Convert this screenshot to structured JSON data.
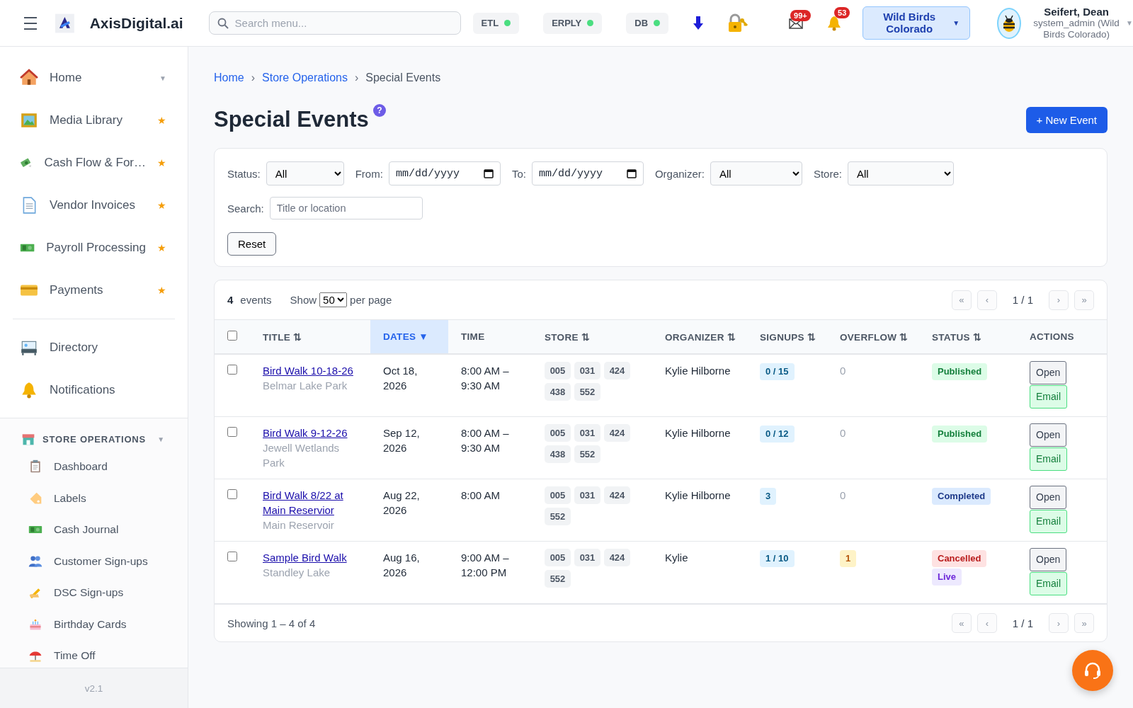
{
  "header": {
    "brand": "AxisDigital.ai",
    "search": {
      "placeholder": "Search menu..."
    },
    "status_chips": [
      {
        "label": "ETL",
        "color": "#4ade80"
      },
      {
        "label": "ERPLY",
        "color": "#4ade80"
      },
      {
        "label": "DB",
        "color": "#4ade80"
      }
    ],
    "mail_badge": "99+",
    "bell_badge": "53",
    "store_button": "Wild Birds Colorado",
    "store_caret": "▼",
    "user": {
      "name": "Seifert, Dean",
      "role": "system_admin (Wild Birds Colorado)",
      "caret": "▼"
    }
  },
  "sidebar": {
    "items": [
      {
        "label": "Home",
        "kind": "caret",
        "trailing_text": "▼"
      },
      {
        "label": "Media Library",
        "kind": "star",
        "trailing_text": "★"
      },
      {
        "label": "Cash Flow & For…",
        "kind": "star",
        "trailing_text": "★"
      },
      {
        "label": "Vendor Invoices",
        "kind": "star",
        "trailing_text": "★"
      },
      {
        "label": "Payroll Processing",
        "kind": "star",
        "trailing_text": "★"
      },
      {
        "label": "Payments",
        "kind": "star",
        "trailing_text": "★"
      }
    ],
    "items_2": [
      {
        "label": "Directory"
      },
      {
        "label": "Notifications"
      }
    ],
    "section": {
      "title": "STORE OPERATIONS",
      "caret": "▼",
      "expanded": true,
      "children": [
        {
          "label": "Dashboard"
        },
        {
          "label": "Labels"
        },
        {
          "label": "Cash Journal"
        },
        {
          "label": "Customer Sign-ups"
        },
        {
          "label": "DSC Sign-ups"
        },
        {
          "label": "Birthday Cards"
        },
        {
          "label": "Time Off"
        }
      ]
    },
    "version": "v2.1"
  },
  "breadcrumb": [
    {
      "label": "Home",
      "link": true
    },
    {
      "label": "Store Operations",
      "link": true
    },
    {
      "label": "Special Events",
      "link": false
    }
  ],
  "breadcrumb_separators": [
    "›",
    "›"
  ],
  "page_title": "Special Events",
  "help": "?",
  "new_button": "+ New Event",
  "filters": [
    {
      "label": "Status:",
      "kind": "select",
      "value": "All"
    },
    {
      "label": "From:",
      "kind": "date",
      "placeholder": "mm/dd/yyyy"
    },
    {
      "label": "To:",
      "kind": "date",
      "placeholder": "mm/dd/yyyy"
    },
    {
      "label": "Organizer:",
      "kind": "select",
      "value": "All"
    },
    {
      "label": "Store:",
      "kind": "select",
      "value": "All"
    },
    {
      "label": "Search:",
      "kind": "text",
      "placeholder": "Title or location"
    }
  ],
  "reset_button": "Reset",
  "summary": {
    "count": "4",
    "count_label": "events",
    "show": "Show",
    "per_page": "50",
    "per_page_label": "per page"
  },
  "pager_top": {
    "buttons": [
      {
        "label": "«",
        "disabled": true
      },
      {
        "label": "‹",
        "disabled": true
      },
      {
        "label": "›",
        "disabled": true
      },
      {
        "label": "»",
        "disabled": true
      }
    ],
    "page": "1 / 1"
  },
  "table": {
    "select_all": {
      "checked": false
    },
    "columns": [
      {
        "label": "TITLE",
        "sort_icon": "⇅",
        "selected": false
      },
      {
        "label": "DATES",
        "sort_icon": "▼",
        "selected": true
      },
      {
        "label": "TIME",
        "selected": false
      },
      {
        "label": "STORE",
        "sort_icon": "⇅",
        "selected": false
      },
      {
        "label": "ORGANIZER",
        "sort_icon": "⇅",
        "selected": false
      },
      {
        "label": "SIGNUPS",
        "sort_icon": "⇅",
        "selected": false
      },
      {
        "label": "OVERFLOW",
        "sort_icon": "⇅",
        "selected": false
      },
      {
        "label": "STATUS",
        "sort_icon": "⇅",
        "selected": false
      },
      {
        "label": "ACTIONS",
        "selected": false
      }
    ],
    "rows": [
      {
        "checked": false,
        "title": "Bird Walk 10-18-26",
        "location": "Belmar Lake Park",
        "date": "Oct 18, 2026",
        "time": "8:00 AM – 9:30 AM",
        "stores": [
          "005",
          "031",
          "424",
          "438",
          "552"
        ],
        "organizer": "Kylie Hilborne",
        "signups": "0 / 15",
        "overflow": "0",
        "overflow_flag": false,
        "statuses": [
          {
            "label": "Published",
            "kind": "published"
          }
        ],
        "actions": [
          "Open",
          "Email"
        ]
      },
      {
        "checked": false,
        "title": "Bird Walk 9-12-26",
        "location": "Jewell Wetlands Park",
        "date": "Sep 12, 2026",
        "time": "8:00 AM – 9:30 AM",
        "stores": [
          "005",
          "031",
          "424",
          "438",
          "552"
        ],
        "organizer": "Kylie Hilborne",
        "signups": "0 / 12",
        "overflow": "0",
        "overflow_flag": false,
        "statuses": [
          {
            "label": "Published",
            "kind": "published"
          }
        ],
        "actions": [
          "Open",
          "Email"
        ]
      },
      {
        "checked": false,
        "title": "Bird Walk 8/22 at Main Reservior",
        "location": "Main Reservoir",
        "date": "Aug 22, 2026",
        "time": "8:00 AM",
        "stores": [
          "005",
          "031",
          "424",
          "552"
        ],
        "organizer": "Kylie Hilborne",
        "signups": "3",
        "overflow": "0",
        "overflow_flag": false,
        "statuses": [
          {
            "label": "Completed",
            "kind": "completed"
          }
        ],
        "actions": [
          "Open",
          "Email"
        ]
      },
      {
        "checked": false,
        "title": "Sample Bird Walk",
        "location": "Standley Lake",
        "date": "Aug 16, 2026",
        "time": "9:00 AM – 12:00 PM",
        "stores": [
          "005",
          "031",
          "424",
          "552"
        ],
        "organizer": "Kylie",
        "signups": "1 / 10",
        "overflow": "1",
        "overflow_flag": true,
        "statuses": [
          {
            "label": "Cancelled",
            "kind": "cancelled"
          },
          {
            "label": "Live",
            "kind": "live"
          }
        ],
        "actions": [
          "Open",
          "Email"
        ]
      }
    ]
  },
  "footer_text": "Showing 1 – 4 of 4",
  "pager_bottom": {
    "buttons": [
      {
        "label": "«",
        "disabled": true
      },
      {
        "label": "‹",
        "disabled": true
      },
      {
        "label": "›",
        "disabled": true
      },
      {
        "label": "»",
        "disabled": true
      }
    ],
    "page": "1 / 1"
  }
}
